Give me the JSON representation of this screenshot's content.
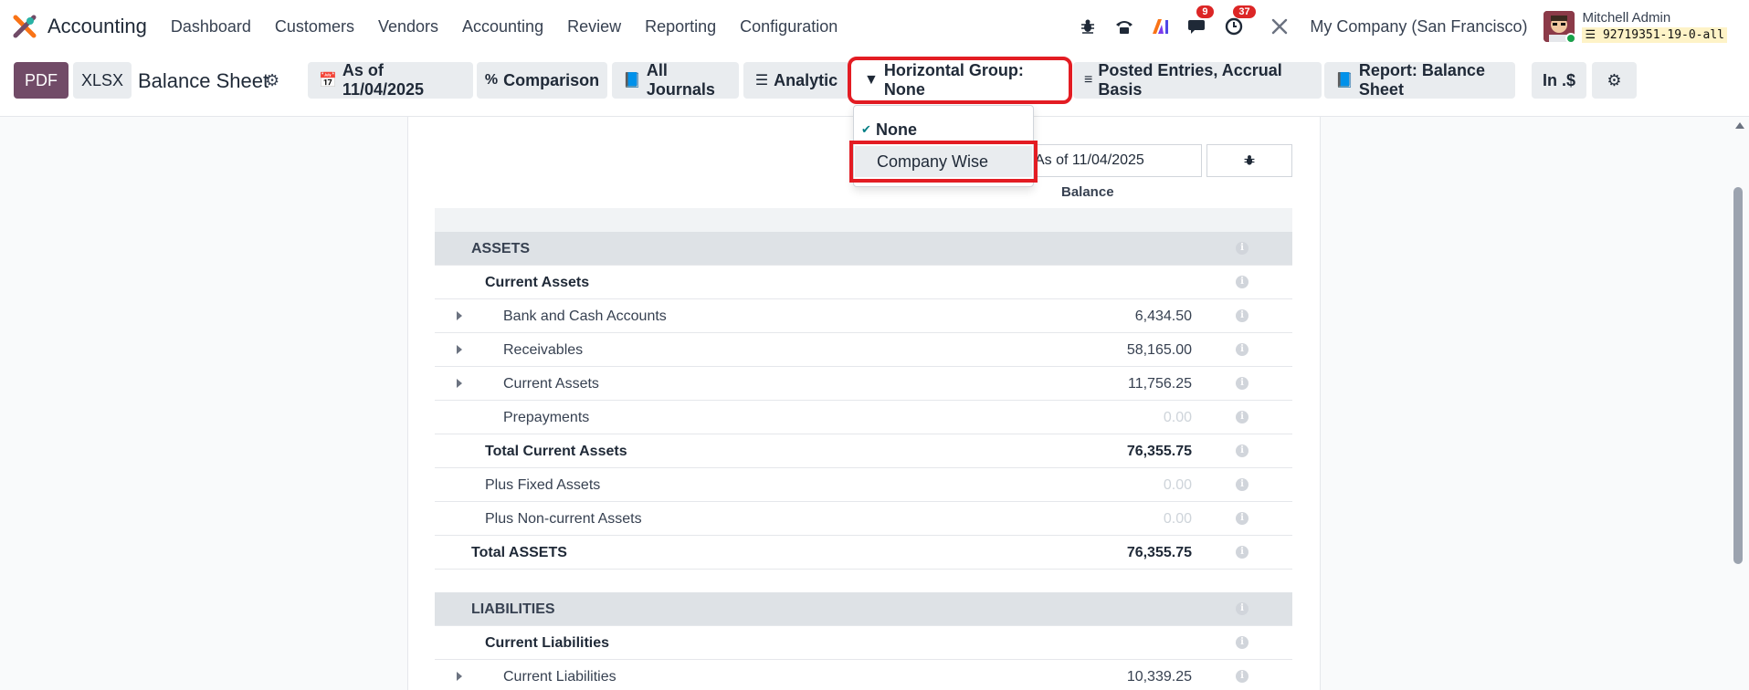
{
  "app": {
    "name": "Accounting"
  },
  "menu": [
    "Dashboard",
    "Customers",
    "Vendors",
    "Accounting",
    "Review",
    "Reporting",
    "Configuration"
  ],
  "nav": {
    "messages_badge": "9",
    "activities_badge": "37",
    "company": "My Company (San Francisco)",
    "user_name": "Mitchell Admin",
    "db_name": "92719351-19-0-all"
  },
  "control": {
    "pdf_label": "PDF",
    "xlsx_label": "XLSX",
    "title": "Balance Sheet",
    "filters": {
      "date": "As of 11/04/2025",
      "comparison": "Comparison",
      "journals": "All Journals",
      "analytic": "Analytic",
      "horizontal_group": "Horizontal Group: None",
      "entries": "Posted Entries, Accrual Basis",
      "report": "Report: Balance Sheet",
      "currency": "In .$"
    }
  },
  "dropdown": {
    "items": [
      {
        "label": "None",
        "checked": true
      },
      {
        "label": "Company Wise",
        "checked": false
      }
    ]
  },
  "report": {
    "column_date": "As of 11/04/2025",
    "column_header": "Balance",
    "rows": [
      {
        "label": "ASSETS",
        "value": "",
        "kind": "section"
      },
      {
        "label": "Current Assets",
        "value": "",
        "kind": "group"
      },
      {
        "label": "Bank and Cash Accounts",
        "value": "6,434.50",
        "kind": "line"
      },
      {
        "label": "Receivables",
        "value": "58,165.00",
        "kind": "line"
      },
      {
        "label": "Current Assets",
        "value": "11,756.25",
        "kind": "line"
      },
      {
        "label": "Prepayments",
        "value": "0.00",
        "kind": "line"
      },
      {
        "label": "Total Current Assets",
        "value": "76,355.75",
        "kind": "total"
      },
      {
        "label": "Plus Fixed Assets",
        "value": "0.00",
        "kind": "sub"
      },
      {
        "label": "Plus Non-current Assets",
        "value": "0.00",
        "kind": "sub"
      },
      {
        "label": "Total ASSETS",
        "value": "76,355.75",
        "kind": "grandtotal"
      },
      {
        "label": "LIABILITIES",
        "value": "",
        "kind": "section"
      },
      {
        "label": "Current Liabilities",
        "value": "",
        "kind": "group"
      },
      {
        "label": "Current Liabilities",
        "value": "10,339.25",
        "kind": "line"
      }
    ]
  },
  "colors": {
    "brand": "#714b67",
    "highlight": "#e31c23",
    "section_bg": "#dee2e6",
    "check": "#017e84"
  }
}
